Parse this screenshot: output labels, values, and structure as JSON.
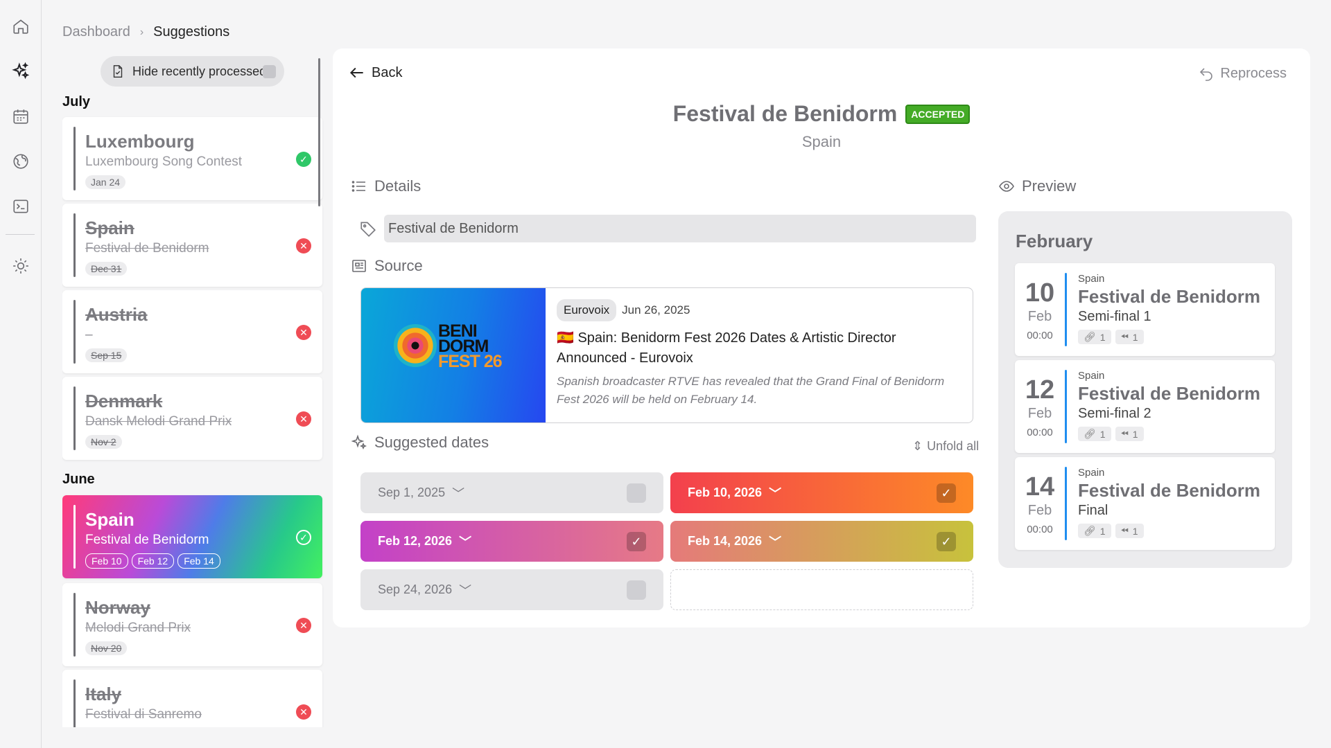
{
  "breadcrumb": {
    "parent": "Dashboard",
    "separator": "›",
    "current": "Suggestions"
  },
  "list": {
    "hide_toggle_label": "Hide recently processed",
    "months": [
      "July",
      "June"
    ],
    "cards": [
      {
        "country": "Luxembourg",
        "event": "Luxembourg Song Contest",
        "dates": [
          "Jan 24"
        ],
        "status": "accepted"
      },
      {
        "country": "Spain",
        "event": "Festival de Benidorm",
        "dates": [
          "Dec 31"
        ],
        "status": "rejected"
      },
      {
        "country": "Austria",
        "event": "–",
        "dates": [
          "Sep 15"
        ],
        "status": "rejected"
      },
      {
        "country": "Denmark",
        "event": "Dansk Melodi Grand Prix",
        "dates": [
          "Nov 2"
        ],
        "status": "rejected"
      },
      {
        "country": "Spain",
        "event": "Festival de Benidorm",
        "dates": [
          "Feb 10",
          "Feb 12",
          "Feb 14"
        ],
        "status": "accepted",
        "selected": true
      },
      {
        "country": "Norway",
        "event": "Melodi Grand Prix",
        "dates": [
          "Nov 20"
        ],
        "status": "rejected"
      },
      {
        "country": "Italy",
        "event": "Festival di Sanremo",
        "dates": [
          ""
        ],
        "status": "rejected"
      }
    ]
  },
  "panel": {
    "back_label": "Back",
    "reprocess_label": "Reprocess",
    "title": "Festival de Benidorm",
    "badge": "ACCEPTED",
    "country": "Spain",
    "details_label": "Details",
    "tag_value": "Festival de Benidorm",
    "source_label": "Source",
    "source": {
      "outlet": "Eurovoix",
      "date": "Jun 26, 2025",
      "flag": "🇪🇸",
      "headline": "Spain: Benidorm Fest 2026 Dates & Artistic Director Announced - Eurovoix",
      "description": "Spanish broadcaster RTVE has revealed that the Grand Final of Benidorm Fest 2026 will be held on February 14.",
      "logo_line1": "BENI",
      "logo_line2": "DORM",
      "logo_line3": "FEST 26"
    },
    "suggested_label": "Suggested dates",
    "unfold_label": "Unfold all",
    "dates": [
      {
        "label": "Sep 1, 2025",
        "checked": false
      },
      {
        "label": "Feb 10, 2026",
        "checked": true
      },
      {
        "label": "Feb 12, 2026",
        "checked": true
      },
      {
        "label": "Feb 14, 2026",
        "checked": true
      },
      {
        "label": "Sep 24, 2026",
        "checked": false
      }
    ],
    "preview_label": "Preview",
    "preview": {
      "month": "February",
      "events": [
        {
          "day": "10",
          "mon": "Feb",
          "time": "00:00",
          "country": "Spain",
          "title": "Festival de Benidorm",
          "stage": "Semi-final 1",
          "links": "1",
          "sources": "1"
        },
        {
          "day": "12",
          "mon": "Feb",
          "time": "00:00",
          "country": "Spain",
          "title": "Festival de Benidorm",
          "stage": "Semi-final 2",
          "links": "1",
          "sources": "1"
        },
        {
          "day": "14",
          "mon": "Feb",
          "time": "00:00",
          "country": "Spain",
          "title": "Festival de Benidorm",
          "stage": "Final",
          "links": "1",
          "sources": "1"
        }
      ]
    }
  },
  "icons": [
    "home-icon",
    "sparkles-icon",
    "calendar-icon",
    "globe-icon",
    "terminal-icon",
    "sun-icon"
  ],
  "colors": {
    "accent_blue": "#1f8ef0",
    "accepted_green": "#44ab26",
    "ok_green": "#2fc768",
    "reject_red": "#ef4c55"
  }
}
